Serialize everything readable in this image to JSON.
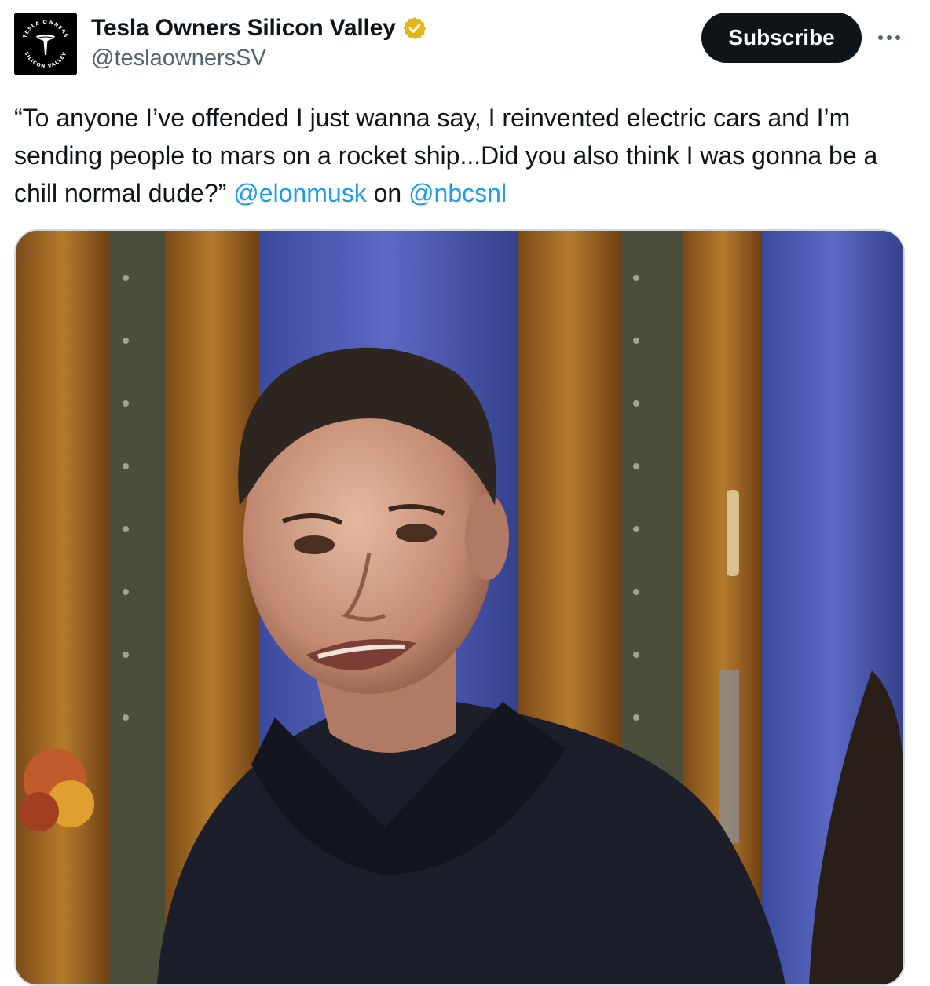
{
  "author": {
    "display_name": "Tesla Owners Silicon Valley",
    "handle": "@teslaownersSV",
    "verified": true,
    "avatar": {
      "icon": "tesla-logo-icon",
      "ring_text_top": "TESLA OWNERS",
      "ring_text_bottom": "SILICON VALLEY"
    }
  },
  "actions": {
    "subscribe_label": "Subscribe",
    "more_icon": "more-horizontal-icon"
  },
  "tweet": {
    "quote_text": "“To anyone I’ve offended I just wanna say, I reinvented electric cars and I’m sending people to mars on a rocket ship...Did you also think I was gonna be a chill normal dude?”",
    "mention_1": "@elonmusk",
    "connector": "on",
    "mention_2": "@nbcsnl"
  },
  "media": {
    "type": "video-still",
    "description_icon": "video-thumbnail"
  },
  "colors": {
    "text_primary": "#0f1419",
    "text_secondary": "#536471",
    "link": "#1d9bf0",
    "verified_badge": "#e2b719",
    "button_bg": "#0f1419"
  }
}
